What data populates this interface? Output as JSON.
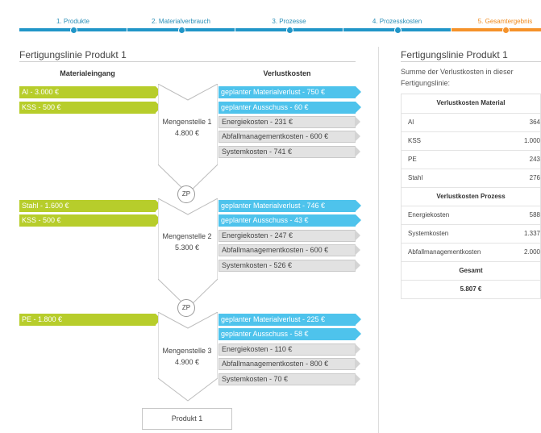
{
  "stepper": {
    "steps": [
      {
        "label": "1. Produkte"
      },
      {
        "label": "2. Materialverbrauch"
      },
      {
        "label": "3. Prozesse"
      },
      {
        "label": "4. Prozesskosten"
      },
      {
        "label": "5. Gesamtergebnis"
      }
    ],
    "active_index": 4,
    "colors": {
      "done": "#2196c8",
      "active": "#f5922a"
    }
  },
  "left_panel": {
    "title": "Fertigungslinie Produkt 1",
    "col_input": "Materialeingang",
    "col_loss": "Verlustkosten",
    "stations": [
      {
        "inputs": [
          "Al - 3.000 €",
          "KSS - 500 €"
        ],
        "name": "Mengenstelle 1",
        "value": "4.800 €",
        "losses": [
          {
            "label": "geplanter Materialverlust - 750 €",
            "kind": "blue"
          },
          {
            "label": "geplanter Ausschuss - 60 €",
            "kind": "blue"
          },
          {
            "label": "Energiekosten - 231 €",
            "kind": "grey"
          },
          {
            "label": "Abfallmanagementkosten - 600 €",
            "kind": "grey"
          },
          {
            "label": "Systemkosten - 741 €",
            "kind": "grey"
          }
        ]
      },
      {
        "inputs": [
          "Stahl - 1.600 €",
          "KSS - 500 €"
        ],
        "name": "Mengenstelle 2",
        "value": "5.300 €",
        "losses": [
          {
            "label": "geplanter Materialverlust - 746 €",
            "kind": "blue"
          },
          {
            "label": "geplanter Ausschuss - 43 €",
            "kind": "blue"
          },
          {
            "label": "Energiekosten - 247 €",
            "kind": "grey"
          },
          {
            "label": "Abfallmanagementkosten - 600 €",
            "kind": "grey"
          },
          {
            "label": "Systemkosten - 526 €",
            "kind": "grey"
          }
        ]
      },
      {
        "inputs": [
          "PE - 1.800 €"
        ],
        "name": "Mengenstelle 3",
        "value": "4.900 €",
        "losses": [
          {
            "label": "geplanter Materialverlust - 225 €",
            "kind": "blue"
          },
          {
            "label": "geplanter Ausschuss - 58 €",
            "kind": "blue"
          },
          {
            "label": "Energiekosten - 110 €",
            "kind": "grey"
          },
          {
            "label": "Abfallmanagementkosten - 800 €",
            "kind": "grey"
          },
          {
            "label": "Systemkosten - 70 €",
            "kind": "grey"
          }
        ]
      }
    ],
    "zp_label": "ZP",
    "product_label": "Produkt 1"
  },
  "right_panel": {
    "title": "Fertigungslinie Produkt 1",
    "description": "Summe der Verlustkosten in dieser Fertigungslinie:",
    "material_head": "Verlustkosten Material",
    "material_rows": [
      {
        "k": "Al",
        "v": "364"
      },
      {
        "k": "KSS",
        "v": "1.000"
      },
      {
        "k": "PE",
        "v": "243"
      },
      {
        "k": "Stahl",
        "v": "276"
      }
    ],
    "process_head": "Verlustkosten Prozess",
    "process_rows": [
      {
        "k": "Energiekosten",
        "v": "588"
      },
      {
        "k": "Systemkosten",
        "v": "1.337"
      },
      {
        "k": "Abfallmanagementkosten",
        "v": "2.000"
      }
    ],
    "total_head": "Gesamt",
    "total_value": "5.807 €"
  }
}
